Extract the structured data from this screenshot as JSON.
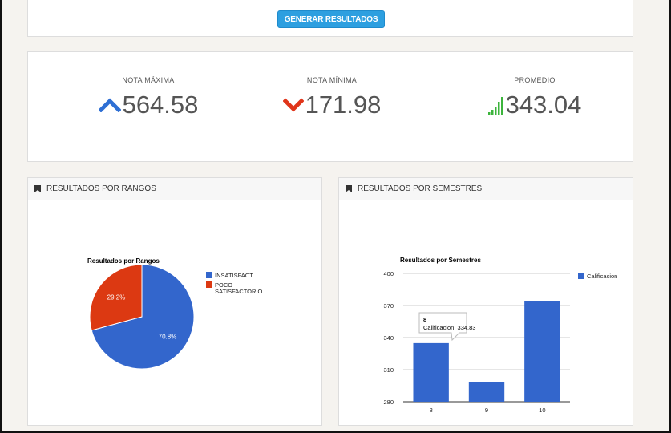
{
  "toolbar": {
    "generate_label": "GENERAR RESULTADOS"
  },
  "stats": [
    {
      "label": "NOTA MÁXIMA",
      "value": "564.58",
      "icon": "chevron-up-icon",
      "color": "#2e6fd4"
    },
    {
      "label": "NOTA MÍNIMA",
      "value": "171.98",
      "icon": "chevron-down-icon",
      "color": "#e0351a"
    },
    {
      "label": "PROMEDIO",
      "value": "343.04",
      "icon": "signal-bars-icon",
      "color": "#3cb43c"
    }
  ],
  "widgets": {
    "ranges": {
      "header": "RESULTADOS POR RANGOS"
    },
    "semesters": {
      "header": "RESULTADOS POR SEMESTRES"
    }
  },
  "chart_data": [
    {
      "type": "pie",
      "title": "Resultados por Rangos",
      "slices": [
        {
          "label": "INSATISFACT...",
          "value": 70.8,
          "display": "70.8%",
          "color": "#3366cc"
        },
        {
          "label": "POCO SATISFACTORIO",
          "value": 29.2,
          "display": "29.2%",
          "color": "#dc3912"
        }
      ],
      "legend_position": "right"
    },
    {
      "type": "bar",
      "title": "Resultados por Semestres",
      "categories": [
        "8",
        "9",
        "10"
      ],
      "series": [
        {
          "name": "Calificacion",
          "values": [
            334.83,
            298,
            374
          ],
          "color": "#3366cc"
        }
      ],
      "ylim": [
        280,
        400
      ],
      "yticks": [
        280,
        310,
        340,
        370,
        400
      ],
      "grid": true,
      "legend_position": "right",
      "tooltip": {
        "title": "8",
        "text": "Calificacion: 334.83"
      }
    }
  ]
}
